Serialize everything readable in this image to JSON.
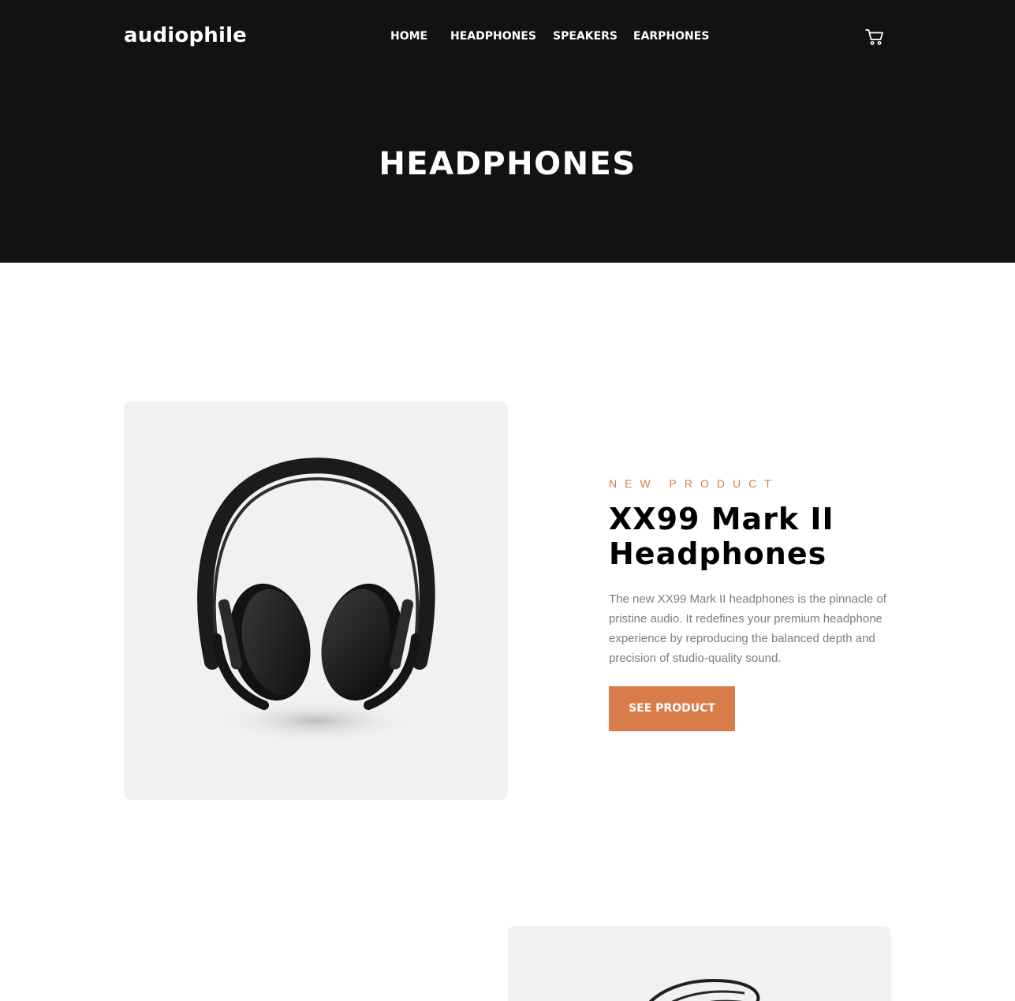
{
  "brand": {
    "logo": "audiophile"
  },
  "nav": {
    "items": [
      {
        "label": "HOME"
      },
      {
        "label": "HEADPHONES"
      },
      {
        "label": "SPEAKERS"
      },
      {
        "label": "EARPHONES"
      }
    ],
    "cart_icon": "cart-icon"
  },
  "hero": {
    "title": "HEADPHONES"
  },
  "products": [
    {
      "overline": "NEW PRODUCT",
      "title_line1": "XX99 Mark II",
      "title_line2": "Headphones",
      "description": "The new XX99 Mark II headphones is the pinnacle of pristine audio. It redefines your premium headphone experience by reproducing the balanced depth and precision of studio-quality sound.",
      "cta_label": "SEE PRODUCT",
      "image_icon": "headphones-image"
    },
    {
      "image_icon": "headphones-image"
    }
  ],
  "colors": {
    "header_bg": "#121212",
    "accent": "#d87d4a",
    "card_bg": "#f1f1f1",
    "text_muted": "#7d7d7d"
  }
}
